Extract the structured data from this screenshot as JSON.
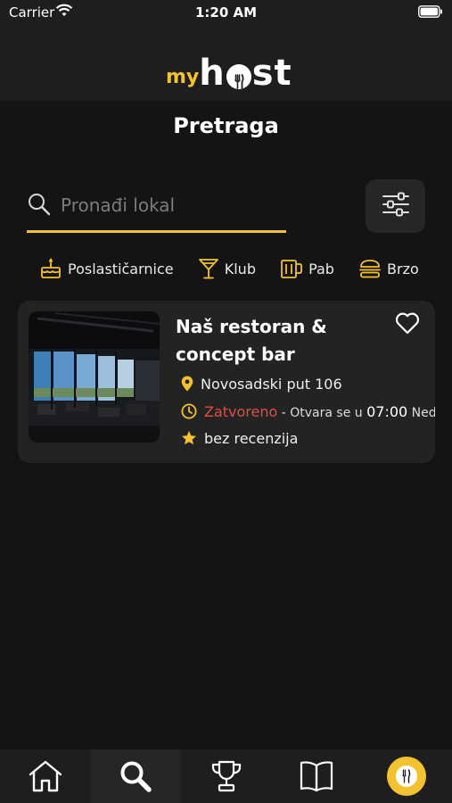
{
  "status_bar": {
    "carrier": "Carrier",
    "time": "1:20 AM"
  },
  "header": {
    "logo_my": "my",
    "logo_h": "h",
    "logo_st": "st"
  },
  "page": {
    "title": "Pretraga"
  },
  "search": {
    "placeholder": "Pronađi lokal",
    "value": ""
  },
  "categories": [
    {
      "label": "Poslastičarnice",
      "icon": "cake-icon"
    },
    {
      "label": "Klub",
      "icon": "cocktail-icon"
    },
    {
      "label": "Pab",
      "icon": "beer-mug-icon"
    },
    {
      "label": "Brzo",
      "icon": "burger-icon"
    }
  ],
  "results": [
    {
      "name": "Naš restoran & concept bar",
      "address": "Novosadski put 106",
      "status": "Zatvoreno",
      "opens_text": "- Otvara se u",
      "opens_time": "07:00",
      "opens_day": "Ned",
      "rating": "bez recenzija"
    }
  ],
  "colors": {
    "accent": "#f2c230",
    "closed": "#e84a3f",
    "background": "#141414",
    "card": "#232323"
  },
  "tab_bar": {
    "items": [
      "home-icon",
      "search-icon",
      "trophy-icon",
      "book-icon",
      "myhost-logo-icon"
    ],
    "active": "search-icon"
  }
}
